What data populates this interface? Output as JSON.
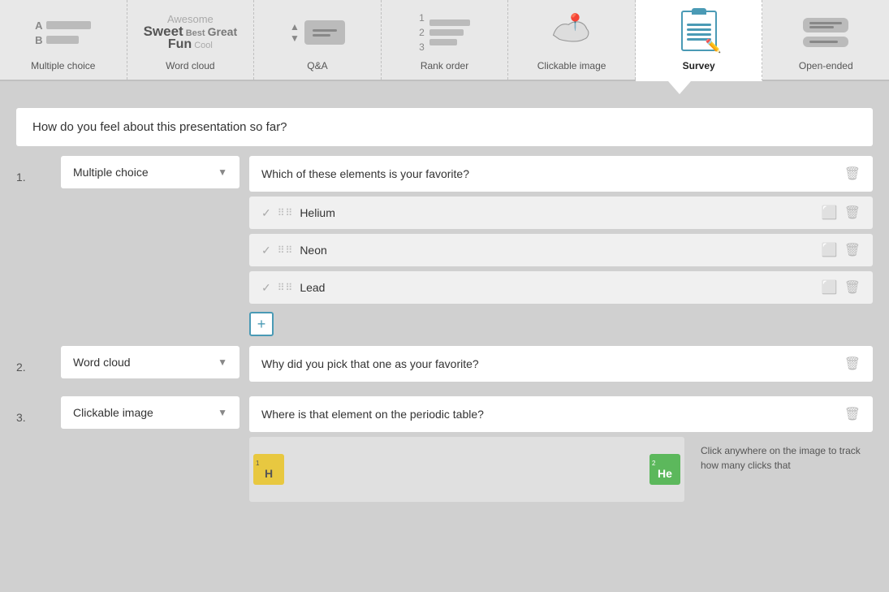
{
  "nav": {
    "items": [
      {
        "id": "multiple-choice",
        "label": "Multiple choice",
        "active": false
      },
      {
        "id": "word-cloud",
        "label": "Word cloud",
        "active": false
      },
      {
        "id": "qa",
        "label": "Q&A",
        "active": false
      },
      {
        "id": "rank-order",
        "label": "Rank order",
        "active": false
      },
      {
        "id": "clickable-image",
        "label": "Clickable image",
        "active": false
      },
      {
        "id": "survey",
        "label": "Survey",
        "active": true
      },
      {
        "id": "open-ended",
        "label": "Open-ended",
        "active": false
      }
    ]
  },
  "survey": {
    "title": "How do you feel about this presentation so far?",
    "questions": [
      {
        "number": "1.",
        "type": "Multiple choice",
        "question_text": "Which of these elements is your favorite?",
        "answers": [
          {
            "text": "Helium"
          },
          {
            "text": "Neon"
          },
          {
            "text": "Lead"
          }
        ]
      },
      {
        "number": "2.",
        "type": "Word cloud",
        "question_text": "Why did you pick that one as your favorite?"
      },
      {
        "number": "3.",
        "type": "Clickable image",
        "question_text": "Where is that element on the periodic table?",
        "hint": "Click anywhere on the image to track how many clicks that"
      }
    ]
  },
  "icons": {
    "delete": "🗑",
    "image": "⬜",
    "add": "+",
    "dropdown_arrow": "▼",
    "check": "✓",
    "drag": "⠿"
  },
  "periodic": {
    "element1_num": "1",
    "element1_symbol": "H",
    "element2_num": "2",
    "element2_symbol": "He"
  }
}
